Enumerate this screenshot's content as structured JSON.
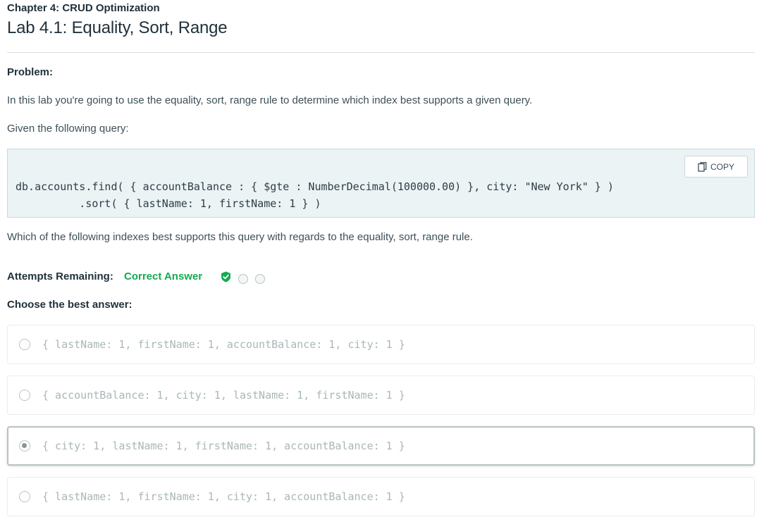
{
  "header": {
    "chapter": "Chapter 4: CRUD Optimization",
    "lab_title": "Lab 4.1: Equality, Sort, Range"
  },
  "problem": {
    "label": "Problem:",
    "intro": "In this lab you're going to use the equality, sort, range rule to determine which index best supports a given query.",
    "given": "Given the following query:",
    "code_line1": "db.accounts.find( { accountBalance : { $gte : NumberDecimal(100000.00) }, city: \"New York\" } )",
    "code_line2": "          .sort( { lastName: 1, firstName: 1 } )",
    "copy_label": "COPY",
    "question": "Which of the following indexes best supports this query with regards to the equality, sort, range rule."
  },
  "attempts": {
    "label": "Attempts Remaining:",
    "status": "Correct Answer",
    "status_color": "#13aa52",
    "indicators": [
      "check-icon",
      "empty-dot",
      "empty-dot"
    ]
  },
  "choose_label": "Choose the best answer:",
  "options": [
    {
      "text": "{ lastName: 1, firstName: 1, accountBalance: 1, city: 1 }",
      "selected": false
    },
    {
      "text": "{ accountBalance: 1, city: 1, lastName: 1, firstName: 1 }",
      "selected": false
    },
    {
      "text": "{ city: 1, lastName: 1, firstName: 1, accountBalance: 1 }",
      "selected": true
    },
    {
      "text": "{ lastName: 1, firstName: 1, city: 1, accountBalance: 1 }",
      "selected": false
    }
  ]
}
